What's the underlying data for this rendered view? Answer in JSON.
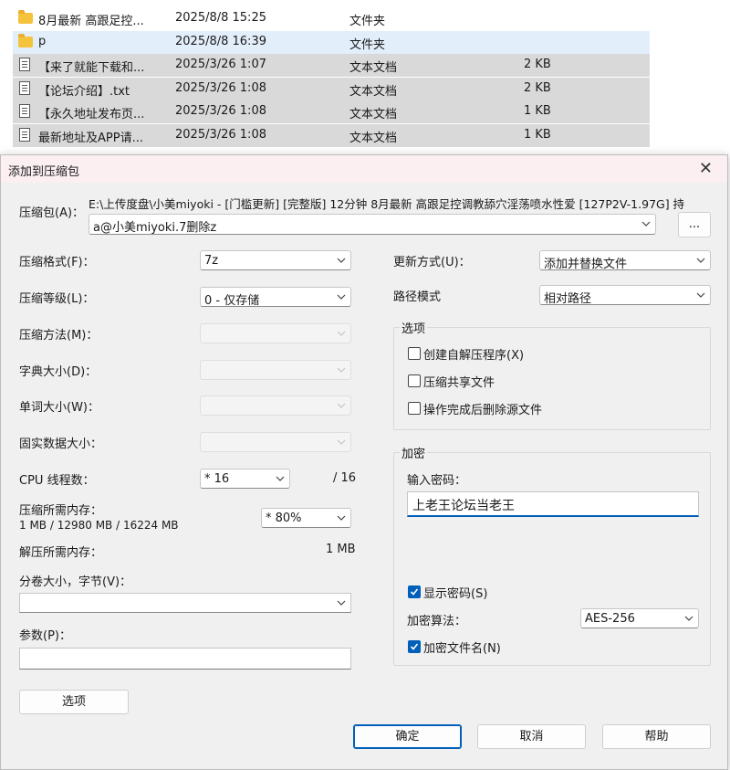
{
  "files": [
    {
      "name": "8月最新 高跟足控...",
      "date": "2025/8/8 15:25",
      "type": "文件夹",
      "size": "",
      "icon": "folder-icon",
      "state": "normal"
    },
    {
      "name": "p",
      "date": "2025/8/8 16:39",
      "type": "文件夹",
      "size": "",
      "icon": "folder-icon",
      "state": "highlight"
    },
    {
      "name": "【来了就能下载和...",
      "date": "2025/3/26 1:07",
      "type": "文本文档",
      "size": "2 KB",
      "icon": "text-file-icon",
      "state": "selected"
    },
    {
      "name": "【论坛介绍】.txt",
      "date": "2025/3/26 1:08",
      "type": "文本文档",
      "size": "2 KB",
      "icon": "text-file-icon",
      "state": "selected"
    },
    {
      "name": "【永久地址发布页...",
      "date": "2025/3/26 1:08",
      "type": "文本文档",
      "size": "1 KB",
      "icon": "text-file-icon",
      "state": "selected"
    },
    {
      "name": "最新地址及APP请...",
      "date": "2025/3/26 1:08",
      "type": "文本文档",
      "size": "1 KB",
      "icon": "text-file-icon",
      "state": "selected"
    }
  ],
  "dialog": {
    "title": "添加到压缩包",
    "close_glyph": "✕",
    "archive_label": "压缩包(A)：",
    "archive_path": "E:\\上传度盘\\小美miyoki - [门槛更新] [完整版] 12分钟 8月最新 高跟足控调教舔穴淫荡喷水性爱 [127P2V-1.97G] 持",
    "archive_name": "a@小美miyoki.7删除z",
    "browse_label": "...",
    "left": {
      "format_label": "压缩格式(F)：",
      "format_value": "7z",
      "level_label": "压缩等级(L)：",
      "level_value": "0 - 仅存储",
      "method_label": "压缩方法(M)：",
      "dict_label": "字典大小(D)：",
      "word_label": "单词大小(W)：",
      "solid_label": "固实数据大小：",
      "cpu_label": "CPU 线程数：",
      "cpu_value": "* 16",
      "cpu_max": "/ 16",
      "mem_label": "压缩所需内存：",
      "mem_detail": "1 MB / 12980 MB / 16224 MB",
      "mem_value": "* 80%",
      "decomp_label": "解压所需内存：",
      "decomp_value": "1 MB",
      "split_label": "分卷大小，字节(V)：",
      "split_value": "",
      "params_label": "参数(P)：",
      "params_value": "",
      "options_button": "选项"
    },
    "right": {
      "update_label": "更新方式(U)：",
      "update_value": "添加并替换文件",
      "path_label": "路径模式",
      "path_value": "相对路径",
      "options_group": "选项",
      "sfx_label": "创建自解压程序(X)",
      "sfx_checked": false,
      "shared_label": "压缩共享文件",
      "shared_checked": false,
      "delete_label": "操作完成后删除源文件",
      "delete_checked": false,
      "encrypt_group": "加密",
      "password_label": "输入密码：",
      "password_value": "上老王论坛当老王",
      "show_pw_label": "显示密码(S)",
      "show_pw_checked": true,
      "algo_label": "加密算法：",
      "algo_value": "AES-256",
      "enc_names_label": "加密文件名(N)",
      "enc_names_checked": true
    },
    "buttons": {
      "ok": "确定",
      "cancel": "取消",
      "help": "帮助"
    }
  },
  "colors": {
    "accent": "#005fb8",
    "selected_row": "#d9d9d9",
    "highlight_row": "#e3eefb",
    "titlebar": "#fbeff2"
  }
}
